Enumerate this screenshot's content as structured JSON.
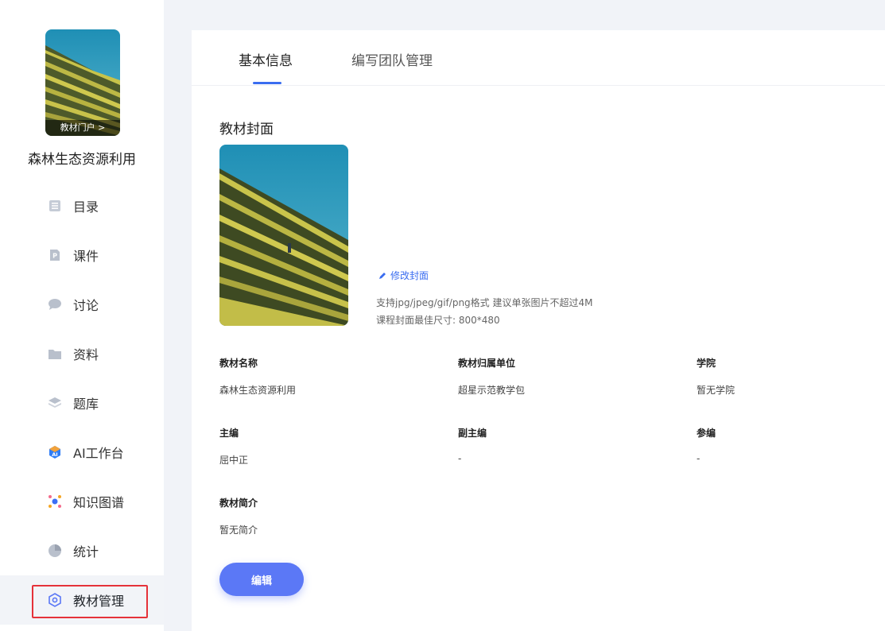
{
  "sidebar": {
    "portal_label": "教材门户 >",
    "course_title": "森林生态资源利用",
    "items": [
      {
        "label": "目录",
        "icon": "list-icon"
      },
      {
        "label": "课件",
        "icon": "ppt-icon"
      },
      {
        "label": "讨论",
        "icon": "chat-bubble-icon"
      },
      {
        "label": "资料",
        "icon": "folder-icon"
      },
      {
        "label": "题库",
        "icon": "layers-icon"
      },
      {
        "label": "AI工作台",
        "icon": "ai-icon"
      },
      {
        "label": "知识图谱",
        "icon": "graph-icon"
      },
      {
        "label": "统计",
        "icon": "pie-chart-icon"
      },
      {
        "label": "教材管理",
        "icon": "settings-hex-icon",
        "active": true
      }
    ]
  },
  "tabs": [
    {
      "label": "基本信息",
      "active": true
    },
    {
      "label": "编写团队管理",
      "active": false
    }
  ],
  "cover": {
    "section_title": "教材封面",
    "edit_link": "修改封面",
    "hint_line1": "支持jpg/jpeg/gif/png格式 建议单张图片不超过4M",
    "hint_line2": "课程封面最佳尺寸: 800*480"
  },
  "fields": {
    "name": {
      "label": "教材名称",
      "value": "森林生态资源利用"
    },
    "unit": {
      "label": "教材归属单位",
      "value": "超星示范教学包"
    },
    "college": {
      "label": "学院",
      "value": "暂无学院"
    },
    "chief_editor": {
      "label": "主编",
      "value": "屈中正"
    },
    "deputy_editor": {
      "label": "副主编",
      "value": "-"
    },
    "contributor": {
      "label": "参编",
      "value": "-"
    },
    "intro": {
      "label": "教材简介",
      "value": "暂无简介"
    }
  },
  "actions": {
    "edit_label": "编辑"
  },
  "colors": {
    "accent": "#3a6df0",
    "button": "#5b78f6",
    "highlight_border": "#e5323a"
  }
}
